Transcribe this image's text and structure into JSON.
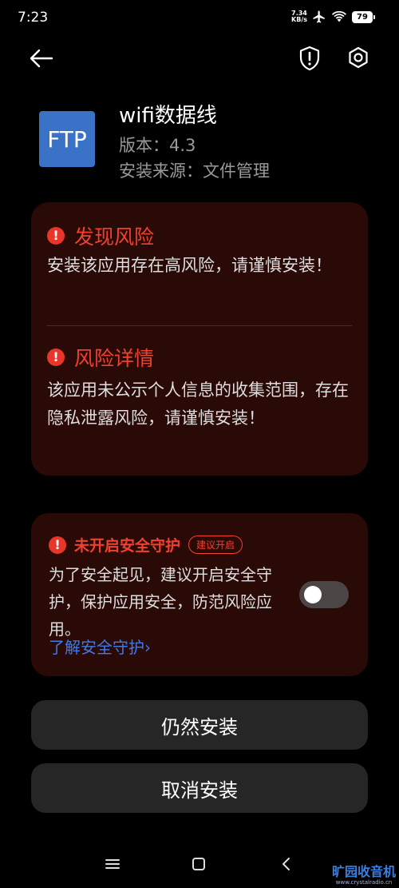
{
  "status_bar": {
    "time": "7:23",
    "speed_value": "7.34",
    "speed_unit": "KB/s",
    "battery": "79",
    "icons": [
      "airplane-icon",
      "wifi-icon",
      "battery-icon"
    ]
  },
  "header": {
    "back_icon": "back-arrow-icon",
    "shield_icon": "shield-exclamation-icon",
    "settings_icon": "gear-icon"
  },
  "app": {
    "icon_text": "FTP",
    "icon_color": "#3a72c8",
    "name": "wifi数据线",
    "version": "版本：4.3",
    "source": "安装来源：文件管理"
  },
  "risk_card": {
    "found_title": "发现风险",
    "found_text": "安装该应用存在高风险，请谨慎安装！",
    "detail_title": "风险详情",
    "detail_text": "该应用未公示个人信息的收集范围，存在隐私泄露风险，请谨慎安装！"
  },
  "protection_card": {
    "title": "未开启安全守护",
    "badge": "建议开启",
    "text": "为了安全起见，建议开启安全守护，保护应用安全，防范风险应用。",
    "link": "了解安全守护›",
    "toggle_on": false
  },
  "buttons": {
    "install": "仍然安装",
    "cancel": "取消安装"
  },
  "nav_bar": {
    "icons": [
      "menu-icon",
      "home-icon",
      "back-icon"
    ]
  },
  "watermark": {
    "top": "旷园收音机",
    "bottom": "www.crystalradio.cn"
  },
  "colors": {
    "accent_red": "#f0402f",
    "card_bg": "#2a0a07",
    "link_blue": "#3f7be8"
  }
}
